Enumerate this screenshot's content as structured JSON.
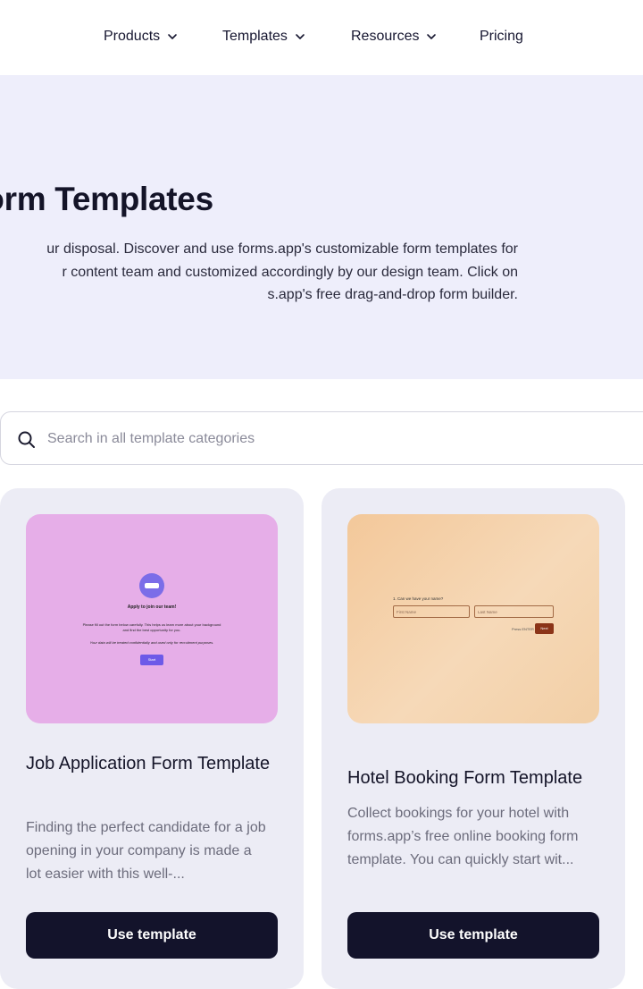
{
  "nav": {
    "items": [
      {
        "label": "Products",
        "has_dropdown": true
      },
      {
        "label": "Templates",
        "has_dropdown": true
      },
      {
        "label": "Resources",
        "has_dropdown": true
      },
      {
        "label": "Pricing",
        "has_dropdown": false
      }
    ]
  },
  "hero": {
    "title": "Form Templates",
    "description_lines": [
      "ur disposal. Discover and use forms.app's customizable form templates for",
      "r content team and customized accordingly by our design team. Click on",
      "s.app's free drag-and-drop form builder."
    ]
  },
  "search": {
    "placeholder": "Search in all template categories",
    "value": ""
  },
  "cards": [
    {
      "title": "Job Application Form Template",
      "description": "Finding the perfect candidate for a job opening in your company is made a lot easier with this well-...",
      "button_label": "Use template",
      "preview": {
        "heading": "Apply to join our team!",
        "line1": "Please fill out the form below carefully. This helps us learn more about your background",
        "line2": "and find the best opportunity for you.",
        "note": "Your data will be treated confidentially and used only for recruitment purposes.",
        "button": "Start",
        "bg_color": "#e6aee8",
        "accent": "#6d5ae8"
      }
    },
    {
      "title": "Hotel Booking Form Template",
      "description": "Collect bookings for your hotel with forms.app’s free online booking form template. You can quickly start wit...",
      "button_label": "Use template",
      "preview": {
        "question": "1. Can we have your name?",
        "first_placeholder": "First Name",
        "last_placeholder": "Last Name",
        "enter_hint": "Press ENTER",
        "button": "Next",
        "accent": "#8b3418"
      }
    }
  ],
  "colors": {
    "hero_bg": "#eeeefb",
    "card_bg": "#ececf5",
    "button_bg": "#13132b"
  }
}
